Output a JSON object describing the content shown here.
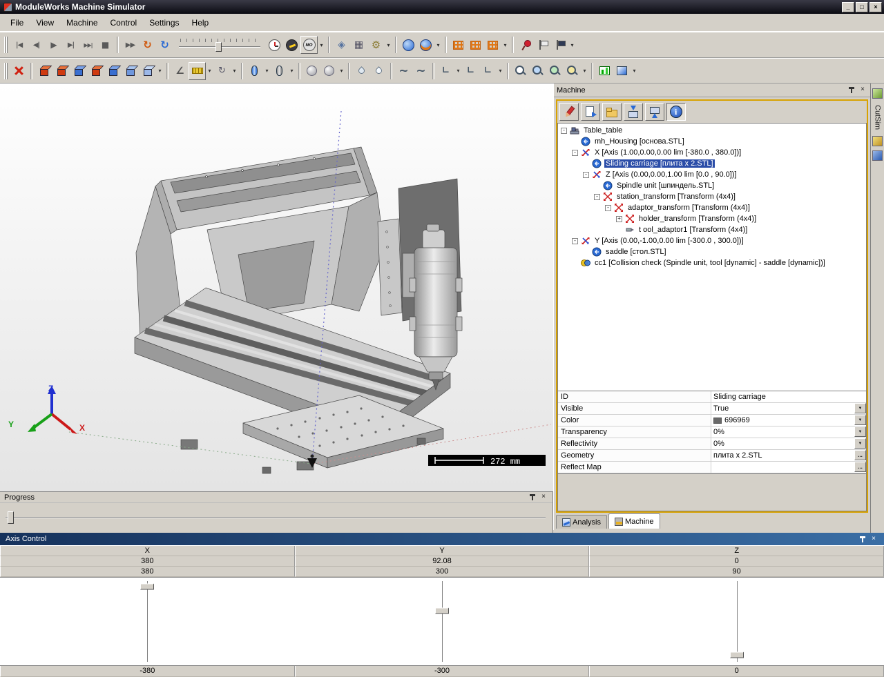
{
  "window": {
    "title": "ModuleWorks Machine Simulator",
    "buttons": {
      "minimize": "_",
      "maximize": "□",
      "close": "×"
    }
  },
  "menu": {
    "items": [
      "File",
      "View",
      "Machine",
      "Control",
      "Settings",
      "Help"
    ]
  },
  "glyphs": {
    "minus": "-",
    "plus": "+",
    "dropdown": "▼",
    "ellipsis": "...",
    "close": "×",
    "no_badge": "NO"
  },
  "toolbars": {
    "row1_icons": [
      "go-to-start-icon",
      "step-back-icon",
      "play-icon",
      "step-forward-icon",
      "go-to-end-icon",
      "stop-icon",
      "fast-forward-icon",
      "replay-icon",
      "refresh-icon",
      "speed-slider",
      "clock-icon",
      "turbo-icon",
      "no-stop-icon",
      "diamond-icon",
      "keyboard-icon",
      "gear-wrench-icon",
      "globe-icon",
      "world-icon",
      "grid-x-icon",
      "grid-y-icon",
      "grid-z-icon",
      "pin-icon",
      "flag-light-icon",
      "flag-dark-icon"
    ],
    "row2_icons": [
      "machine-axes-icon",
      "stock-cube-1",
      "stock-cube-2",
      "stock-cube-3",
      "stock-cube-4",
      "stock-cube-5",
      "stock-cube-6",
      "stock-cube-7",
      "measure-angle-icon",
      "measure-ruler-icon",
      "measure-rotate-icon",
      "turning-blue-icon",
      "turning-gray-icon",
      "sphere-1-icon",
      "sphere-2-icon",
      "coolant-1-icon",
      "coolant-2-icon",
      "curve-1-icon",
      "curve-2-icon",
      "path-1-icon",
      "path-2-icon",
      "path-3-icon",
      "zoom-1-icon",
      "zoom-2-icon",
      "zoom-3-icon",
      "zoom-4-icon",
      "chart-icon",
      "shade-icon"
    ]
  },
  "viewport": {
    "scale_label": "272 mm",
    "axis_labels": {
      "x": "X",
      "y": "Y",
      "z": "Z"
    }
  },
  "machine_panel": {
    "title": "Machine",
    "toolbar_icons": [
      "edit-icon",
      "import-doc-icon",
      "open-folder-icon",
      "save-icon",
      "send-icon",
      "info-icon"
    ],
    "tree": {
      "items": [
        {
          "label": "Table_table",
          "level": 0,
          "icon": "machine-icon",
          "expander": "minus"
        },
        {
          "label": "mh_Housing [основа.STL]",
          "level": 1,
          "icon": "geometry-icon",
          "expander": "none"
        },
        {
          "label": "X [Axis (1.00,0.00,0.00 lim [-380.0 , 380.0])]",
          "level": 1,
          "icon": "axis-icon",
          "expander": "minus"
        },
        {
          "label": "Sliding carriage [плита x 2.STL]",
          "level": 2,
          "icon": "geometry-icon",
          "expander": "none",
          "selected": true
        },
        {
          "label": "Z [Axis (0.00,0.00,1.00 lim [0.0 , 90.0])]",
          "level": 2,
          "icon": "axis-icon",
          "expander": "minus"
        },
        {
          "label": "Spindle unit [шпиндель.STL]",
          "level": 3,
          "icon": "geometry-icon",
          "expander": "none"
        },
        {
          "label": "station_transform [Transform (4x4)]",
          "level": 3,
          "icon": "transform-icon",
          "expander": "minus"
        },
        {
          "label": "adaptor_transform [Transform (4x4)]",
          "level": 4,
          "icon": "transform-icon",
          "expander": "minus"
        },
        {
          "label": "holder_transform [Transform (4x4)]",
          "level": 5,
          "icon": "transform-icon",
          "expander": "plus"
        },
        {
          "label": "t ool_adaptor1 [Transform (4x4)]",
          "level": 5,
          "icon": "tool-icon",
          "expander": "none"
        },
        {
          "label": "Y [Axis (0.00,-1.00,0.00 lim [-300.0 , 300.0])]",
          "level": 1,
          "icon": "axis-icon",
          "expander": "minus"
        },
        {
          "label": "saddle [стол.STL]",
          "level": 2,
          "icon": "geometry-icon",
          "expander": "none"
        },
        {
          "label": "cc1 [Collision check (Spindle unit, tool [dynamic] - saddle [dynamic])]",
          "level": 1,
          "icon": "collision-icon",
          "expander": "none"
        }
      ]
    },
    "properties": {
      "rows": [
        {
          "name": "ID",
          "value": "Sliding carriage",
          "control": "none"
        },
        {
          "name": "Visible",
          "value": "True",
          "control": "dropdown"
        },
        {
          "name": "Color",
          "value": "696969",
          "control": "dropdown",
          "swatch": "#696969"
        },
        {
          "name": "Transparency",
          "value": "0%",
          "control": "dropdown"
        },
        {
          "name": "Reflectivity",
          "value": "0%",
          "control": "dropdown"
        },
        {
          "name": "Geometry",
          "value": "плита x 2.STL",
          "control": "ellipsis"
        },
        {
          "name": "Reflect Map",
          "value": "",
          "control": "ellipsis"
        }
      ]
    },
    "tabs": {
      "analysis": {
        "label": "Analysis"
      },
      "machine": {
        "label": "Machine"
      }
    }
  },
  "progress_panel": {
    "title": "Progress",
    "slider_pos": 0.004
  },
  "axis_control": {
    "title": "Axis Control",
    "columns": [
      {
        "axis": "X",
        "current": "380",
        "limit": "380",
        "min": "-380",
        "slider_pos": 0.1
      },
      {
        "axis": "Y",
        "current": "92.08",
        "limit": "300",
        "min": "-300",
        "slider_pos": 0.375
      },
      {
        "axis": "Z",
        "current": "0",
        "limit": "90",
        "min": "0",
        "slider_pos": 0.88
      }
    ]
  },
  "cutsim": {
    "label": "CutSim"
  }
}
